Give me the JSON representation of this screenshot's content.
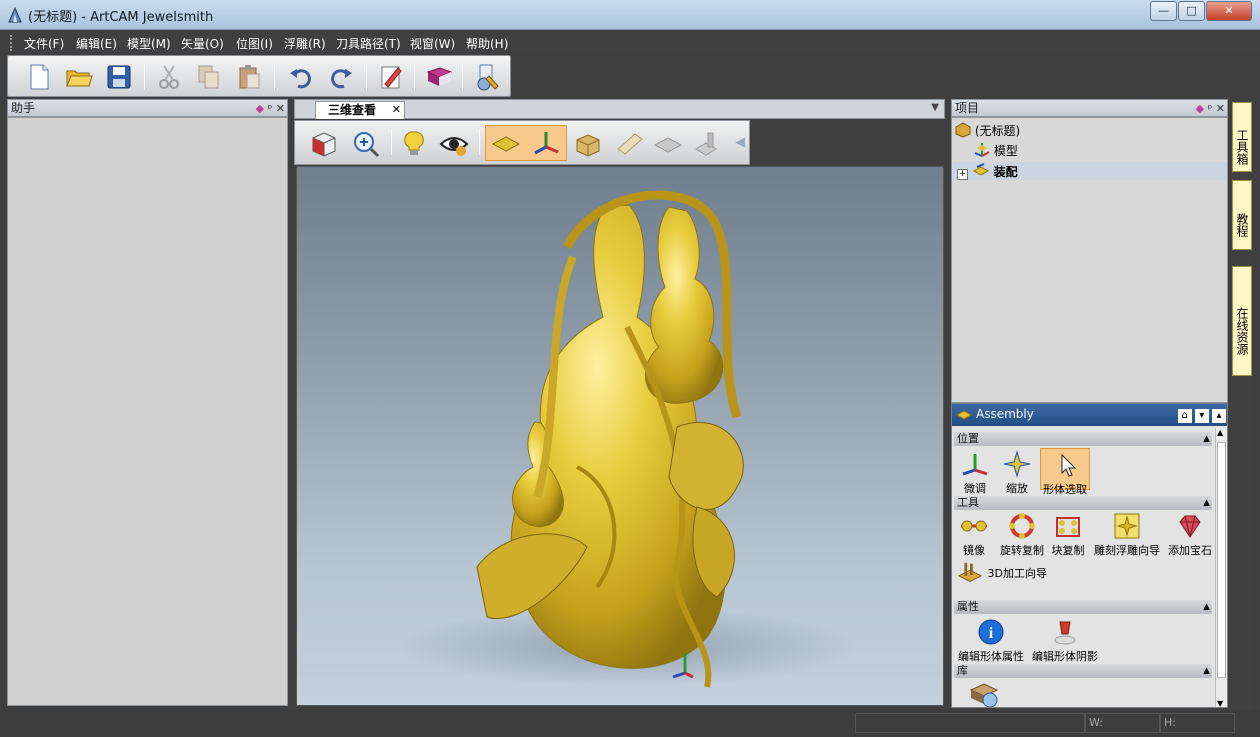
{
  "window": {
    "title": "(无标题) - ArtCAM Jewelsmith",
    "controls": {
      "minimize": "—",
      "maximize": "□",
      "close": "✕"
    }
  },
  "menu": [
    {
      "label": "文件(F)"
    },
    {
      "label": "编辑(E)"
    },
    {
      "label": "模型(M)"
    },
    {
      "label": "矢量(O)"
    },
    {
      "label": "位图(I)"
    },
    {
      "label": "浮雕(R)"
    },
    {
      "label": "刀具路径(T)"
    },
    {
      "label": "视窗(W)"
    },
    {
      "label": "帮助(H)"
    }
  ],
  "toolbar": {
    "icons": [
      "new-file",
      "open-folder",
      "save",
      "cut",
      "copy",
      "paste",
      "undo",
      "redo",
      "edit-notes",
      "book",
      "settings-wizard"
    ]
  },
  "left_panel": {
    "title": "助手"
  },
  "document": {
    "tab_label": "三维查看",
    "close_glyph": "✕",
    "dropdown_glyph": "▼"
  },
  "project_panel": {
    "title": "项目",
    "tree": [
      {
        "label": "(无标题)",
        "level": 0
      },
      {
        "label": "模型",
        "level": 1
      },
      {
        "label": "装配",
        "level": 1,
        "expander": "+"
      }
    ]
  },
  "side_tabs": [
    {
      "label": "工具箱"
    },
    {
      "label": "教程"
    },
    {
      "label": "在线资源"
    }
  ],
  "assembly": {
    "title": "Assembly",
    "sections": {
      "position": {
        "title": "位置",
        "tools": [
          {
            "label": "微调"
          },
          {
            "label": "缩放"
          },
          {
            "label": "形体选取"
          }
        ]
      },
      "tools": {
        "title": "工具",
        "tools": [
          {
            "label": "镜像"
          },
          {
            "label": "旋转复制"
          },
          {
            "label": "块复制"
          },
          {
            "label": "雕刻浮雕向导"
          },
          {
            "label": "添加宝石"
          },
          {
            "label": "3D加工向导"
          }
        ]
      },
      "properties": {
        "title": "属性",
        "tools": [
          {
            "label": "编辑形体属性"
          },
          {
            "label": "编辑形体阴影"
          }
        ]
      },
      "library": {
        "title": "库"
      }
    }
  },
  "status_bar": {
    "w_label": "W:",
    "h_label": "H:"
  },
  "colors": {
    "gold": "#e0c133",
    "gold_dark": "#8f7410",
    "accent_blue": "#2a5a96",
    "highlight_orange": "#f7c98b"
  }
}
